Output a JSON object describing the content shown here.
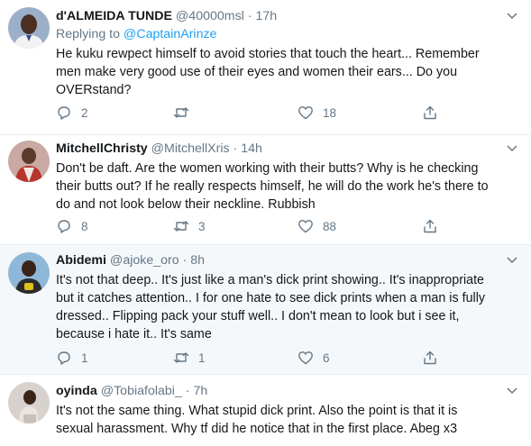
{
  "tweets": [
    {
      "name": "d'ALMEIDA TUNDE",
      "handle": "@40000msl",
      "sep": "·",
      "time": "17h",
      "replying_prefix": "Replying to ",
      "replying_to": "@CaptainArinze",
      "lines": [
        "He kuku rewpect himself to avoid stories that touch the heart... Remember",
        "men make very good use of their eyes and women their ears... Do you",
        "OVERstand?"
      ],
      "replies": "2",
      "retweets": "",
      "likes": "18",
      "avatar_bg": "#9bb0c8"
    },
    {
      "name": "MitchellChristy",
      "handle": "@MitchellXris",
      "sep": "·",
      "time": "14h",
      "lines": [
        "Don't be daft. Are the women working with their butts? Why is he checking",
        "their butts out? If he really respects himself, he will do the work he's there to",
        "do and not look below their neckline. Rubbish"
      ],
      "replies": "8",
      "retweets": "3",
      "likes": "88",
      "avatar_bg": "#c9a9a3"
    },
    {
      "name": "Abidemi",
      "handle": "@ajoke_oro",
      "sep": "·",
      "time": "8h",
      "lines": [
        "It's not that deep.. It's just like a man's dick print showing.. It's inappropriate",
        "but it catches attention.. I for one hate to see dick prints when a man is fully",
        "dressed.. Flipping pack your stuff well.. I don't mean to look but i see it,",
        "because i hate it.. It's same"
      ],
      "replies": "1",
      "retweets": "1",
      "likes": "6",
      "avatar_bg": "#8fb8d8"
    },
    {
      "name": "oyinda",
      "handle": "@Tobiafolabi_",
      "sep": "·",
      "time": "7h",
      "lines": [
        "It's not the same thing. What stupid dick print. Also the point is that it is",
        "sexual harassment. Why tf did he notice that in the first place. Abeg x3"
      ],
      "avatar_bg": "#d8d2cf"
    }
  ],
  "colors": {
    "text": "#14171a",
    "muted": "#657786",
    "link": "#1da1f2",
    "divider": "#e6ecf0",
    "shaded": "#f5f8fa"
  },
  "icons": [
    "caret-down-icon",
    "reply-icon",
    "retweet-icon",
    "like-icon",
    "share-icon"
  ]
}
